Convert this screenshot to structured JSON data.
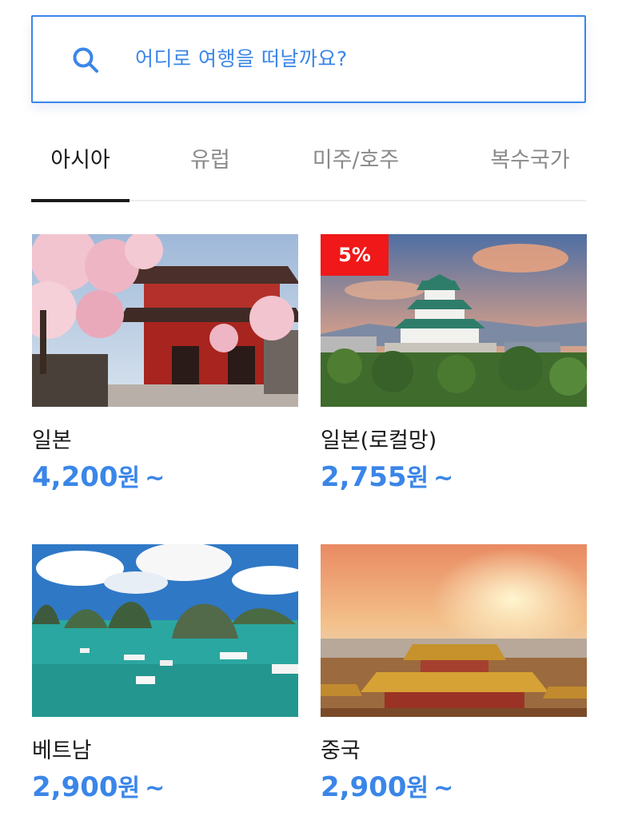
{
  "search": {
    "placeholder": "어디로 여행을 떠날까요?",
    "icon": "search-icon",
    "accent_color": "#3a86e8"
  },
  "tabs": [
    {
      "label": "아시아",
      "active": true
    },
    {
      "label": "유럽",
      "active": false
    },
    {
      "label": "미주/호주",
      "active": false
    },
    {
      "label": "복수국가",
      "active": false
    }
  ],
  "cards": [
    {
      "name": "일본",
      "price": "4,200",
      "unit": "원",
      "suffix": "~",
      "badge": ""
    },
    {
      "name": "일본(로컬망)",
      "price": "2,755",
      "unit": "원",
      "suffix": "~",
      "badge": "5%"
    },
    {
      "name": "베트남",
      "price": "2,900",
      "unit": "원",
      "suffix": "~",
      "badge": ""
    },
    {
      "name": "중국",
      "price": "2,900",
      "unit": "원",
      "suffix": "~",
      "badge": ""
    }
  ],
  "colors": {
    "price": "#3a86e8",
    "badge": "#f01818",
    "active_tab": "#1a1a1a",
    "inactive_tab": "#8a8a8a"
  }
}
